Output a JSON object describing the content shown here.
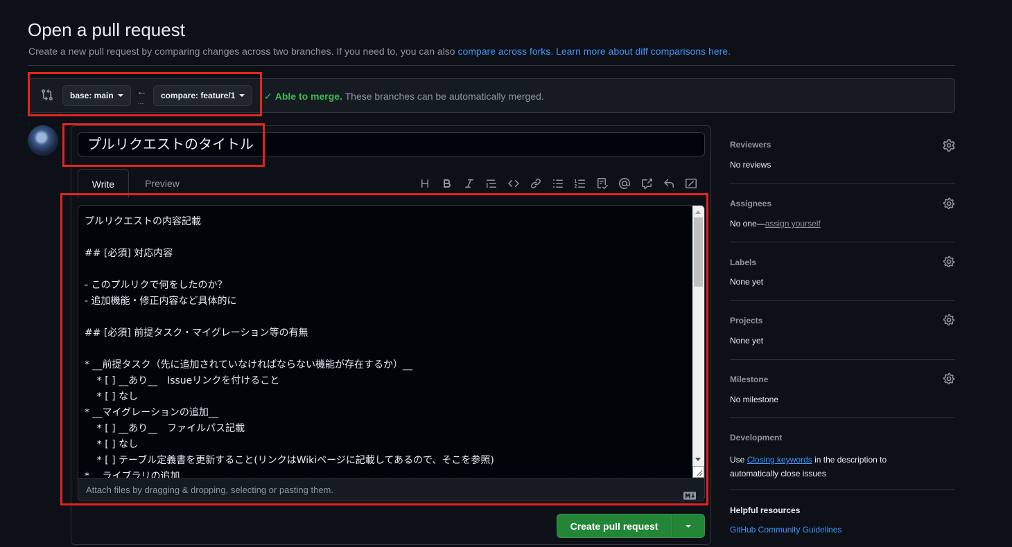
{
  "header": {
    "title": "Open a pull request",
    "subtitle_prefix": "Create a new pull request by comparing changes across two branches. If you need to, you can also ",
    "compare_forks_link": "compare across forks.",
    "learn_more_link": "Learn more about diff comparisons here."
  },
  "compare": {
    "base_label": "base: main",
    "compare_label": "compare: feature/1",
    "dots": "...",
    "merge_ok": "Able to merge.",
    "merge_text": "These branches can be automatically merged."
  },
  "form": {
    "title_value": "プルリクエストのタイトル",
    "tab_write": "Write",
    "tab_preview": "Preview",
    "body_lines": [
      "プルリクエストの内容記載",
      "",
      "## [必須] 対応内容",
      "",
      "- このプルリクで何をしたのか？",
      "- 追加機能・修正内容など具体的に",
      "",
      "## [必須] 前提タスク・マイグレーション等の有無",
      "",
      "* __前提タスク（先に追加されていなければならない機能が存在するか）__",
      "    * [ ] __あり__　Issueリンクを付けること",
      "    * [ ] なし",
      "* __マイグレーションの追加__",
      "    * [ ] __あり__　ファイルパス記載",
      "    * [ ] なし",
      "    * [ ] テーブル定義書を更新すること(リンクはWikiページに記載してあるので、そこを参照)",
      "* __ライブラリの追加__"
    ],
    "attach_hint": "Attach files by dragging & dropping, selecting or pasting them.",
    "create_button": "Create pull request"
  },
  "toolbar_icons": [
    "heading-icon",
    "bold-icon",
    "italic-icon",
    "quote-icon",
    "code-icon",
    "link-icon",
    "unordered-list-icon",
    "ordered-list-icon",
    "task-list-icon",
    "mention-icon",
    "cross-reference-icon",
    "reply-icon",
    "fullscreen-icon"
  ],
  "sidebar": {
    "reviewers": {
      "label": "Reviewers",
      "value": "No reviews"
    },
    "assignees": {
      "label": "Assignees",
      "value_prefix": "No one—",
      "link": "assign yourself"
    },
    "labels": {
      "label": "Labels",
      "value": "None yet"
    },
    "projects": {
      "label": "Projects",
      "value": "None yet"
    },
    "milestone": {
      "label": "Milestone",
      "value": "No milestone"
    },
    "development": {
      "label": "Development",
      "text_prefix": "Use ",
      "link": "Closing keywords",
      "text_suffix": " in the description to",
      "text_line2": "automatically close issues"
    },
    "helpful": {
      "label": "Helpful resources",
      "link": "GitHub Community Guidelines"
    }
  },
  "colors": {
    "background": "#0d1117",
    "accent_link": "#4493f8",
    "success": "#3fb950",
    "primary_button": "#238636",
    "highlight_box": "#e52321"
  }
}
